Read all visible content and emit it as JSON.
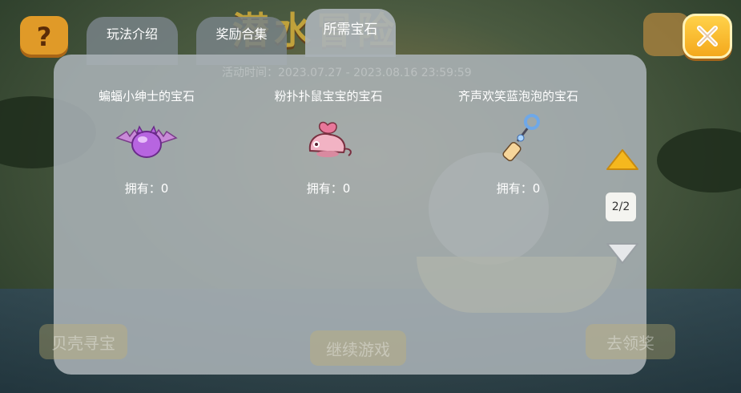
{
  "tabs": [
    {
      "label": "玩法介绍",
      "active": false
    },
    {
      "label": "奖励合集",
      "active": false
    },
    {
      "label": "所需宝石",
      "active": true
    }
  ],
  "background": {
    "title": "潜水冒险",
    "event_time": "活动时间：2023.07.27 - 2023.08.16 23:59:59",
    "left_button": "贝壳寻宝",
    "continue_button": "继续游戏",
    "claim_button": "去领奖"
  },
  "gems": [
    {
      "name": "蝙蝠小绅士的宝石",
      "owned_label": "拥有：0",
      "icon": "purple-bat-gem-icon"
    },
    {
      "name": "粉扑扑鼠宝宝的宝石",
      "owned_label": "拥有：0",
      "icon": "pink-mouse-gem-icon"
    },
    {
      "name": "齐声欢笑蓝泡泡的宝石",
      "owned_label": "拥有：0",
      "icon": "bubble-wand-gem-icon"
    }
  ],
  "pagination": {
    "label": "2/2"
  },
  "colors": {
    "accent": "#f5b81e",
    "panel": "#aab2b6"
  }
}
